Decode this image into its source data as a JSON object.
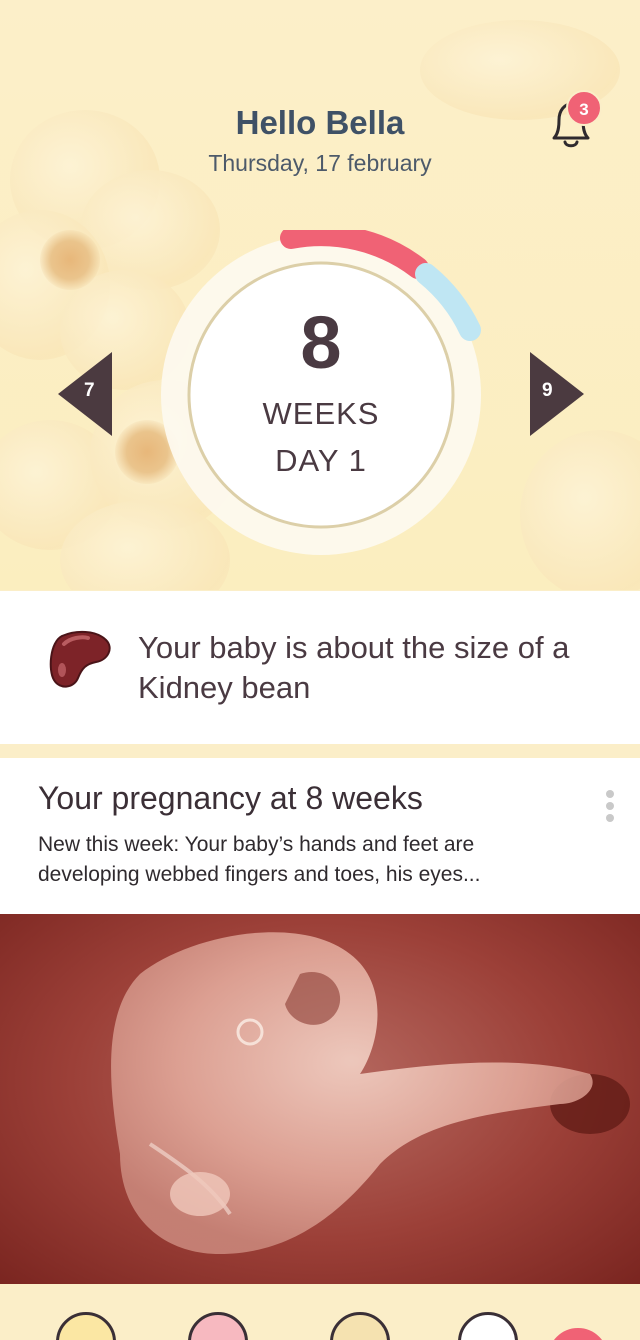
{
  "header": {
    "greeting": "Hello Bella",
    "date": "Thursday, 17 february",
    "notifications_count": "3"
  },
  "progress": {
    "week": "8",
    "weeks_label": "WEEKS",
    "day_label": "DAY 1",
    "prev_week": "7",
    "next_week": "9",
    "colors": {
      "primary": "#f06275",
      "secondary": "#bfe6f3"
    }
  },
  "size_card": {
    "text": "Your baby is about the size of a Kidney bean",
    "icon": "kidney-bean-icon"
  },
  "article": {
    "title": "Your pregnancy at 8 weeks",
    "summary": "New this week: Your baby’s hands and feet are developing webbed fingers and toes, his eyes..."
  },
  "tabbar": {
    "icons": [
      "baby-face-icon",
      "no-sign-icon",
      "bandage-icon",
      "compass-icon",
      "add-icon"
    ]
  }
}
